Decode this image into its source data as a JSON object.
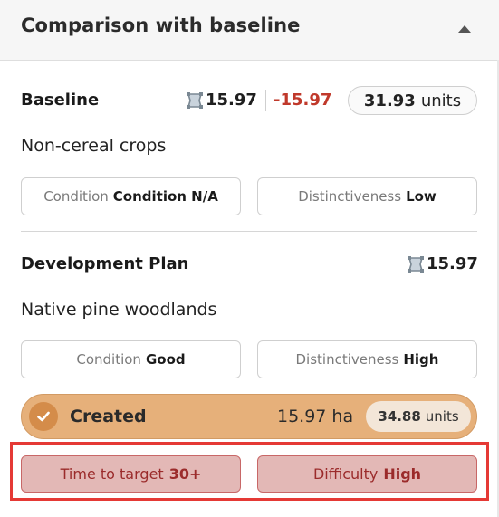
{
  "header": {
    "title": "Comparison with baseline",
    "collapse_icon": "chevron-up-icon"
  },
  "baseline": {
    "title": "Baseline",
    "area": "15.97",
    "change": "-15.97",
    "units_value": "31.93",
    "units_label": "units",
    "habitat": "Non-cereal crops",
    "condition_label": "Condition",
    "condition_value": "Condition N/A",
    "distinctiveness_label": "Distinctiveness",
    "distinctiveness_value": "Low"
  },
  "plan": {
    "title": "Development Plan",
    "area": "15.97",
    "habitat": "Native pine woodlands",
    "condition_label": "Condition",
    "condition_value": "Good",
    "distinctiveness_label": "Distinctiveness",
    "distinctiveness_value": "High"
  },
  "created": {
    "label": "Created",
    "area": "15.97 ha",
    "units_value": "34.88",
    "units_label": "units"
  },
  "targets": {
    "time_label": "Time to target",
    "time_value": "30+",
    "difficulty_label": "Difficulty",
    "difficulty_value": "High"
  },
  "colors": {
    "negative": "#c0392b",
    "created_bg": "#e6b07a",
    "warning_bg": "#e3b8b6",
    "warning_text": "#9b2b2b",
    "highlight": "#e53935"
  }
}
